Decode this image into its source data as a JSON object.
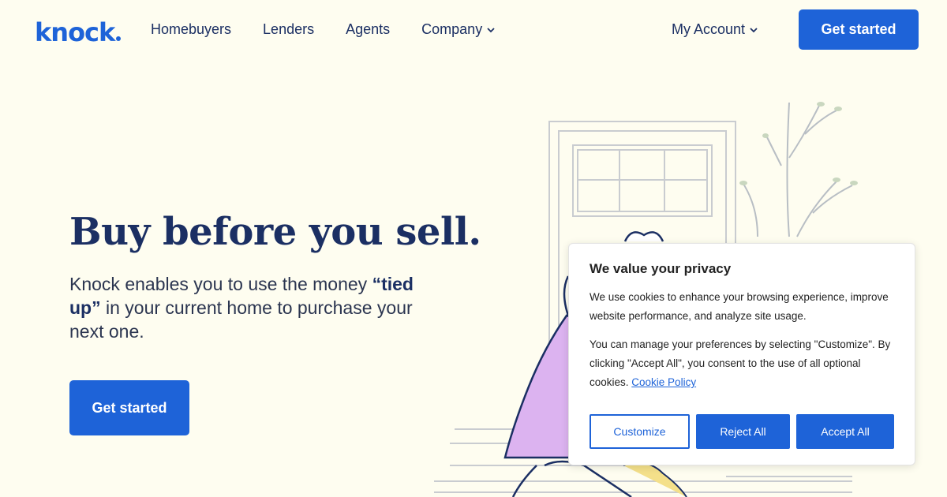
{
  "brand": {
    "name": "knock",
    "accent": "#1e63d8",
    "text": "#1b2f63",
    "background": "#fefdf0"
  },
  "nav": {
    "items": [
      {
        "label": "Homebuyers"
      },
      {
        "label": "Lenders"
      },
      {
        "label": "Agents"
      },
      {
        "label": "Company",
        "icon": "chevron-down-icon"
      }
    ],
    "account_label": "My Account",
    "cta_label": "Get started"
  },
  "hero": {
    "title": "Buy before you sell.",
    "subtitle_pre": "Knock enables you to use the money ",
    "subtitle_bold": "“tied up”",
    "subtitle_post": " in your current home to purchase your next one.",
    "cta_label": "Get started"
  },
  "cookie": {
    "title": "We value your privacy",
    "para1": "We use cookies to enhance your browsing experience, improve website performance, and analyze site usage.",
    "para2": "You can manage your preferences by selecting \"Customize\". By clicking \"Accept All\", you consent to the use of all optional cookies. ",
    "policy_link": "Cookie Policy",
    "buttons": {
      "customize": "Customize",
      "reject": "Reject All",
      "accept": "Accept All"
    }
  }
}
